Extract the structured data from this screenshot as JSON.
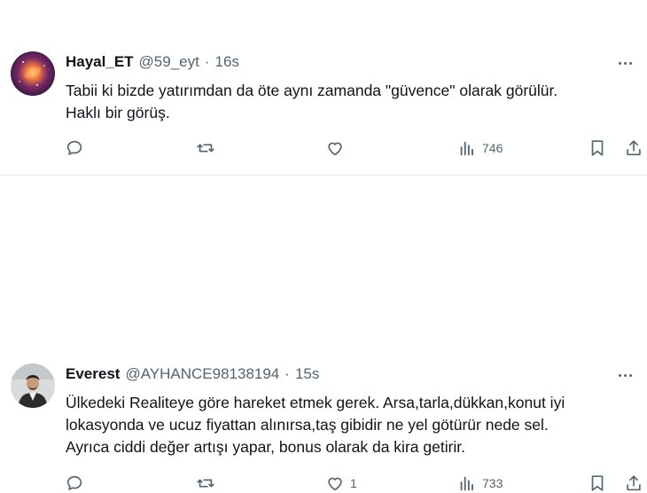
{
  "tweets": [
    {
      "display_name": "Hayal_ET",
      "handle": "@59_eyt",
      "separator": "·",
      "time": "16s",
      "text_lines": [
        "Tabii ki bizde yatırımdan da öte aynı zamanda \"güvence\" olarak görülür.",
        "Haklı bir görüş."
      ],
      "like_count": "",
      "view_count": "746",
      "avatar_colors": [
        "#f07a3a",
        "#7b2a66",
        "#1d1333"
      ]
    },
    {
      "display_name": "Everest",
      "handle": "@AYHANCE98138194",
      "separator": "·",
      "time": "15s",
      "text_lines": [
        "Ülkedeki Realiteye göre hareket etmek gerek. Arsa,tarla,dükkan,konut iyi",
        "lokasyonda ve ucuz fiyattan alınırsa,taş gibidir ne yel götürür nede sel.",
        "Ayrıca ciddi değer artışı yapar, bonus olarak da kira getirir."
      ],
      "like_count": "1",
      "view_count": "733",
      "avatar_colors": [
        "#d9dbdc",
        "#2f2b29",
        "#eadfd4"
      ]
    }
  ],
  "icons": {
    "reply": "reply-icon",
    "retweet": "retweet-icon",
    "like": "like-icon",
    "views": "views-icon",
    "bookmark": "bookmark-icon",
    "share": "share-icon",
    "more": "more-icon"
  },
  "colors": {
    "text": "#0f1419",
    "secondary": "#536471",
    "divider": "#e7e9ea",
    "background": "#ffffff"
  }
}
